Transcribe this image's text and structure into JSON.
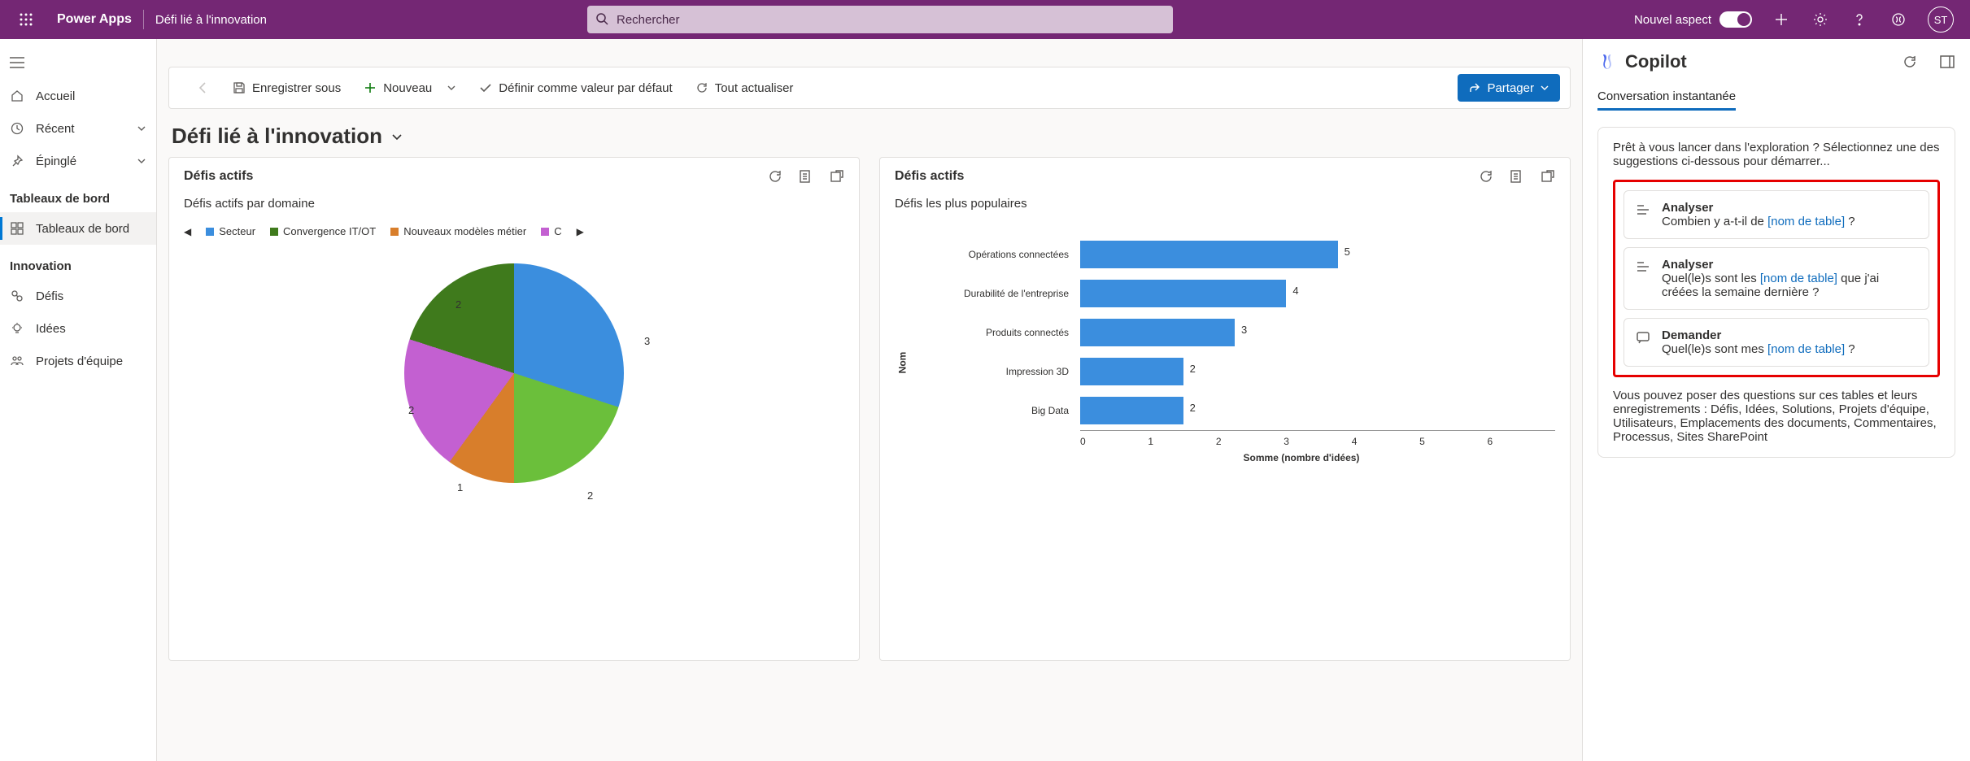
{
  "topbar": {
    "brand": "Power Apps",
    "page": "Défi lié à l'innovation",
    "search_placeholder": "Rechercher",
    "new_aspect": "Nouvel aspect",
    "avatar": "ST"
  },
  "leftnav": {
    "home": "Accueil",
    "recent": "Récent",
    "pinned": "Épinglé",
    "section1": "Tableaux de bord",
    "dashboards": "Tableaux de bord",
    "section2": "Innovation",
    "defis": "Défis",
    "idees": "Idées",
    "projets": "Projets d'équipe"
  },
  "cmdbar": {
    "save_as": "Enregistrer sous",
    "nouveau": "Nouveau",
    "default": "Définir comme valeur par défaut",
    "refresh": "Tout actualiser",
    "share": "Partager"
  },
  "dashboard": {
    "title": "Défi lié à l'innovation"
  },
  "card1": {
    "title": "Défis actifs",
    "sub": "Défis actifs par domaine",
    "legend": {
      "a": "Secteur",
      "b": "Convergence IT/OT",
      "c": "Nouveaux modèles métier",
      "d": "C"
    }
  },
  "card2": {
    "title": "Défis actifs",
    "sub": "Défis les plus populaires",
    "ylabel": "Nom",
    "xlabel": "Somme (nombre d'idées)"
  },
  "chart_data": [
    {
      "type": "pie",
      "title": "Défis actifs par domaine",
      "series": [
        {
          "name": "Secteur",
          "value": 3,
          "color": "#3b8ede"
        },
        {
          "name": "Convergence IT/OT",
          "value": 2,
          "color": "#3f7a1c"
        },
        {
          "name": "Nouveaux modèles métier",
          "value": 1,
          "color": "#d87e2b"
        },
        {
          "name": "C",
          "value": 2,
          "color": "#c360d1"
        },
        {
          "name": "(vert clair)",
          "value": 2,
          "color": "#6bbf3b"
        }
      ]
    },
    {
      "type": "bar",
      "title": "Défis les plus populaires",
      "xlabel": "Somme (nombre d'idées)",
      "ylabel": "Nom",
      "xlim": [
        0,
        6
      ],
      "categories": [
        "Opérations connectées",
        "Durabilité de l'entreprise",
        "Produits connectés",
        "Impression 3D",
        "Big Data"
      ],
      "values": [
        5,
        4,
        3,
        2,
        2
      ]
    }
  ],
  "copilot": {
    "title": "Copilot",
    "tab": "Conversation instantanée",
    "intro": "Prêt à vous lancer dans l'exploration ? Sélectionnez une des suggestions ci-dessous pour démarrer...",
    "prompts": [
      {
        "title": "Analyser",
        "pre": "Combien y a-t-il de ",
        "slot": "[nom de table]",
        "post": " ?"
      },
      {
        "title": "Analyser",
        "pre": "Quel(le)s sont les ",
        "slot": "[nom de table]",
        "post": " que j'ai créées la semaine dernière ?"
      },
      {
        "title": "Demander",
        "pre": "Quel(le)s sont mes ",
        "slot": "[nom de table]",
        "post": " ?"
      }
    ],
    "outro": "Vous pouvez poser des questions sur ces tables et leurs enregistrements : Défis, Idées, Solutions, Projets d'équipe, Utilisateurs, Emplacements des documents, Commentaires, Processus, Sites SharePoint"
  }
}
